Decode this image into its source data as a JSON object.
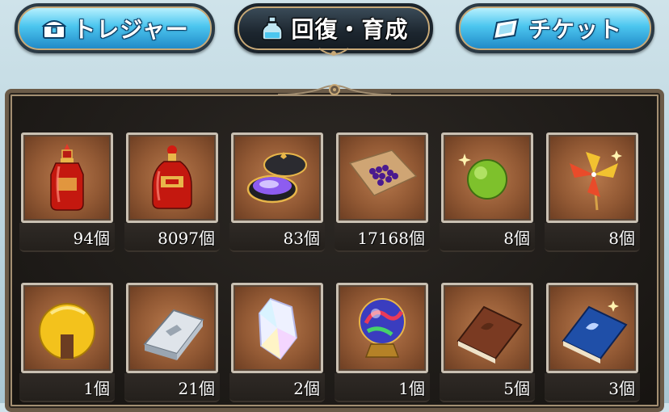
{
  "tabs": [
    {
      "label": "トレジャー",
      "icon": "treasure-chest-icon",
      "active": false
    },
    {
      "label": "回復・育成",
      "icon": "potion-bottle-icon",
      "active": true
    },
    {
      "label": "チケット",
      "icon": "ticket-icon",
      "active": false
    }
  ],
  "colors": {
    "tab_blue": "#4cc6ef",
    "tab_dark": "#1c262f",
    "panel_bg": "#1d1a17",
    "item_bg": "#925934",
    "gold_trim": "#c8a977"
  },
  "items": [
    {
      "count": "94個",
      "icon": "full-elixir-icon"
    },
    {
      "count": "8097個",
      "icon": "half-elixir-icon"
    },
    {
      "count": "83個",
      "icon": "soul-berry-box-icon"
    },
    {
      "count": "17168個",
      "icon": "soul-seed-icon"
    },
    {
      "count": "8個",
      "icon": "green-orb-icon"
    },
    {
      "count": "8個",
      "icon": "pinwheel-icon"
    },
    {
      "count": "1個",
      "icon": "gold-moon-icon"
    },
    {
      "count": "21個",
      "icon": "silver-ingot-icon"
    },
    {
      "count": "2個",
      "icon": "crystal-icon"
    },
    {
      "count": "1個",
      "icon": "crystal-ball-icon"
    },
    {
      "count": "5個",
      "icon": "brown-book-icon"
    },
    {
      "count": "3個",
      "icon": "blue-book-icon"
    }
  ]
}
